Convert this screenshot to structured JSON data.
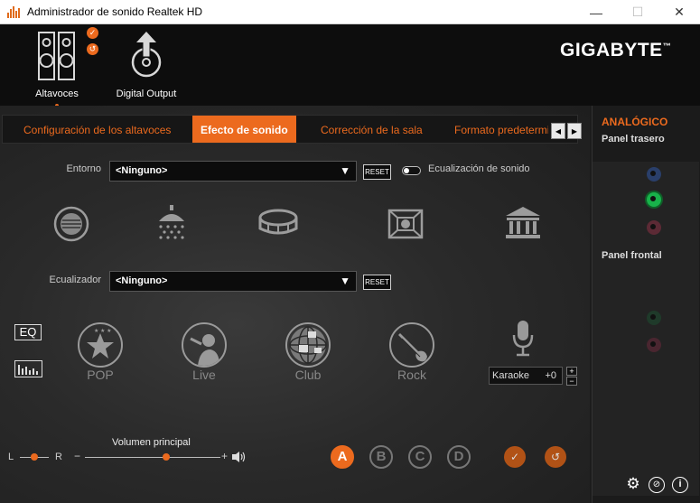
{
  "window": {
    "title": "Administrador de sonido Realtek HD",
    "minimize": "—",
    "maximize": "☐",
    "close": "✕"
  },
  "header": {
    "devices": [
      {
        "label": "Altavoces",
        "icon": "speakers-icon",
        "active": true
      },
      {
        "label": "Digital Output",
        "icon": "digital-output-icon",
        "active": false
      }
    ],
    "brand": "GIGABYTE",
    "brand_mark": "™"
  },
  "tabs": {
    "items": [
      {
        "label": "Configuración de los altavoces",
        "active": false
      },
      {
        "label": "Efecto de sonido",
        "active": true
      },
      {
        "label": "Corrección de la sala",
        "active": false
      },
      {
        "label": "Formato predetermi",
        "active": false
      }
    ],
    "prev": "◀",
    "next": "▶"
  },
  "environment": {
    "label": "Entorno",
    "value": "<Ninguno>",
    "reset": "RESET",
    "toggle_label": "Ecualización de sonido",
    "toggle_on": false,
    "icons": [
      "sewer-icon",
      "shower-icon",
      "stadium-icon",
      "room-icon",
      "hall-icon"
    ]
  },
  "equalizer": {
    "label": "Ecualizador",
    "value": "<Ninguno>",
    "reset": "RESET",
    "eq_button": "EQ",
    "presets": [
      "POP",
      "Live",
      "Club",
      "Rock"
    ],
    "karaoke_label": "Karaoke",
    "karaoke_value": "+0",
    "plus": "+",
    "minus": "−"
  },
  "volume": {
    "label": "Volumen principal",
    "left": "L",
    "right": "R",
    "minus": "−",
    "plus": "+",
    "balance_level": 0.5,
    "volume_level": 0.6
  },
  "profiles": [
    "A",
    "B",
    "C",
    "D"
  ],
  "active_profile": "A",
  "right_panel": {
    "title": "ANALÓGICO",
    "rear": "Panel trasero",
    "front": "Panel frontal"
  },
  "colors": {
    "accent": "#ec6a1e",
    "jack_blue": "#2a3f6a",
    "jack_green": "#18b24a",
    "jack_pink": "#5c2a35"
  }
}
